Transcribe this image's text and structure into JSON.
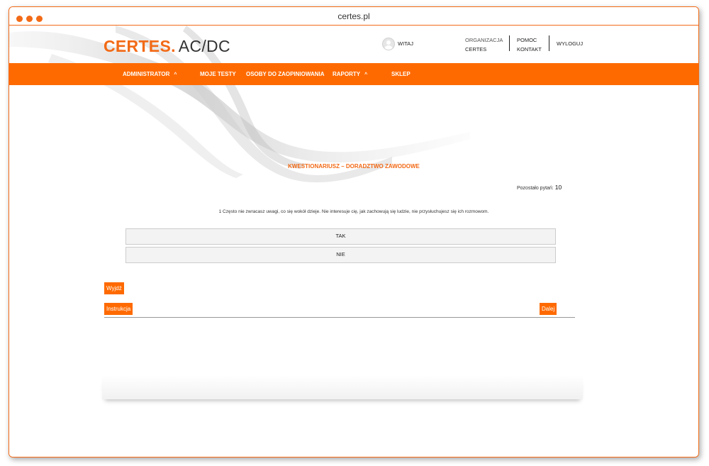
{
  "browser": {
    "url": "certes.pl"
  },
  "header": {
    "brand": "CERTES.",
    "product": "AC/DC",
    "greeting": "WITAJ",
    "org_label": "ORGANIZACJA",
    "org_name": "CERTES",
    "help": "POMOC",
    "contact": "KONTAKT",
    "logout": "WYLOGUJ"
  },
  "nav": {
    "items": [
      {
        "label": "ADMINISTRATOR",
        "has_caret": true
      },
      {
        "label": "MOJE TESTY",
        "has_caret": false
      },
      {
        "label": "OSOBY DO ZAOPINIOWANIA",
        "has_caret": false
      },
      {
        "label": "RAPORTY",
        "has_caret": true
      },
      {
        "label": "SKLEP",
        "has_caret": false
      }
    ],
    "caret": "^"
  },
  "questionnaire": {
    "title": "KWESTIONARIUSZ – DORADZTWO ZAWODOWE",
    "remaining_label": "Pozostało pytań:",
    "remaining_count": "10",
    "question": "1 Często nie zwracasz uwagi, co się wokół dzieje. Nie interesuje cię, jak zachowują się ludzie, nie przysłuchujesz się ich rozmowom.",
    "answers": [
      "TAK",
      "NIE"
    ]
  },
  "buttons": {
    "exit": "Wyjdź",
    "instructions": "Instrukcja",
    "next": "Dalej"
  },
  "colors": {
    "accent": "#ff6a00",
    "frame": "#f26a16"
  }
}
